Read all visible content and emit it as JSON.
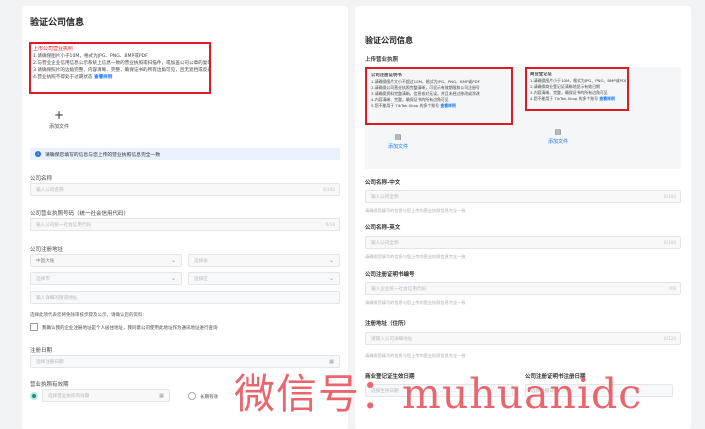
{
  "left": {
    "title": "验证公司信息",
    "license_section": "上市公司营业执照",
    "requirements": [
      "1.请确保图片小于10M，格式为JPG、PNG、BMP或PDF",
      "2.与营业企业信用信息公示系统上信息一致的营业执照或扫描件，或加盖公司公章的复印件",
      "3.请确保照片的边角完整，内容清晰、完整，确保证书的所有边角可见，且无遮挡或反光",
      "4.营业执照不得处于过期状态"
    ],
    "requirements_link": "查看样例",
    "upload_label": "添加文件",
    "info_text": "请确保您填写的信息与您上传的营业执照信息完全一致",
    "company_name_label": "公司名称",
    "company_name_placeholder": "输入公司名称",
    "company_name_count": "0/100",
    "license_no_label": "公司营业执照号码（统一社会信用代码）",
    "license_no_placeholder": "输入公司统一社会信用代码",
    "license_no_count": "0/18",
    "address_label": "公司注册地址",
    "country_value": "中国大陆",
    "province_placeholder": "选择省",
    "city_placeholder": "选择市",
    "district_placeholder": "选择区",
    "detail_placeholder": "输入详细的街道地址",
    "notice_text": "选择此项代表您将免除审核步骤及公示，请确认您的资料：",
    "checkbox_text": "我确认我的企业注册地址是个人居住地址，我同意公司使用此地址作为通讯地址进行查询",
    "reg_date_label": "注册日期",
    "reg_date_placeholder": "选择注册日期",
    "validity_label": "营业执照有效期",
    "validity_placeholder": "选择营业执照有效期",
    "long_term_label": "长期有效"
  },
  "right": {
    "title": "验证公司信息",
    "license_section": "上传营业执照",
    "box1_title": "公司注册证明书",
    "box1_lines": [
      "1.请确保图片大小不超过10M，格式为JPG、PNG、BMP或PDF",
      "2.请确保公司营业执照完整清晰，可显示有效期限和公司注册号",
      "3.请确保资料完整清晰，信息核对无误，并且未经过修改或涂改",
      "4.内容清晰、完整，确保证书的所有边角可见",
      "5.您不能用于 TikTok Shop 的多个账号"
    ],
    "box1_link": "查看样例",
    "box2_title": "商业登记证",
    "box2_lines": [
      "1.请确保图片小于10M，格式为JPG、PNG、BMP或PDF",
      "2.请确保商业登记证清晰地显示有效日期",
      "3.内容清晰、完整，确保证书的所有边角可见",
      "4.您不能用于 TikTok Shop 的多个账号"
    ],
    "box2_link": "查看样例",
    "upload1_label": "添加文件",
    "upload2_label": "添加文件",
    "name_cn_label": "公司名称-中文",
    "name_cn_placeholder": "输入公司全称",
    "name_cn_count": "0/100",
    "name_cn_hint": "请确保您填写的信息与您上传的营业执照信息完全一致",
    "name_en_label": "公司名称-英文",
    "name_en_placeholder": "输入公司全称",
    "name_en_count": "0/100",
    "name_en_hint": "请确保您填写的信息与您上传的营业执照信息完全一致",
    "reg_no_label": "公司注册证明书编号",
    "reg_no_placeholder": "输入企业统一社会信用代码",
    "reg_no_count": "0/8",
    "reg_no_hint": "请确保您填写的信息与您上传的营业执照信息完全一致",
    "address_label": "注册地址（住所）",
    "address_placeholder": "请输入公司详细地址",
    "address_count": "0/120",
    "address_hint": "请确保您填写的信息与您上传的营业执照信息完全一致",
    "brc_date_label": "商业登记证生效日期",
    "cert_date_label": "公司注册证明书注册日期",
    "brc_date_placeholder": "选择生效日期",
    "cert_date_placeholder": "选择注册日期"
  },
  "watermark": "微信号：muhuanidc"
}
